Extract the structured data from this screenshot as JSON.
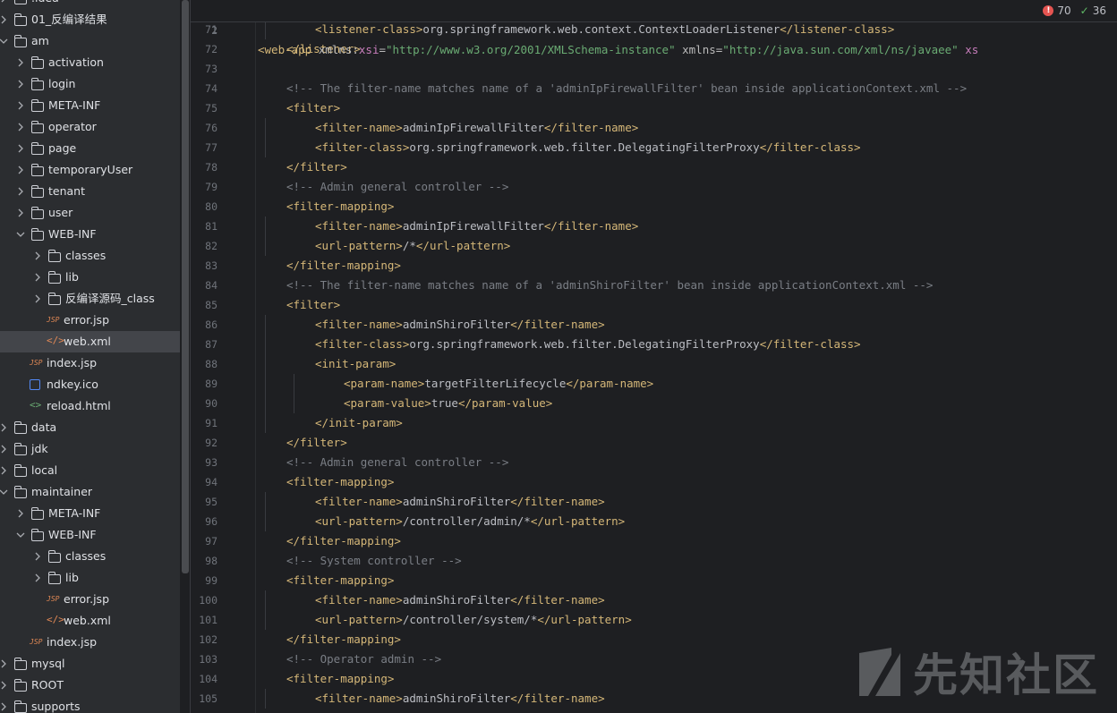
{
  "tree": [
    {
      "label": ".idea",
      "depth": 0,
      "type": "folder",
      "state": "collapsed"
    },
    {
      "label": "01_反编译结果",
      "depth": 0,
      "type": "folder",
      "state": "collapsed"
    },
    {
      "label": "am",
      "depth": 0,
      "type": "folder",
      "state": "expanded"
    },
    {
      "label": "activation",
      "depth": 1,
      "type": "folder",
      "state": "collapsed"
    },
    {
      "label": "login",
      "depth": 1,
      "type": "folder",
      "state": "collapsed"
    },
    {
      "label": "META-INF",
      "depth": 1,
      "type": "folder",
      "state": "collapsed"
    },
    {
      "label": "operator",
      "depth": 1,
      "type": "folder",
      "state": "collapsed"
    },
    {
      "label": "page",
      "depth": 1,
      "type": "folder",
      "state": "collapsed"
    },
    {
      "label": "temporaryUser",
      "depth": 1,
      "type": "folder",
      "state": "collapsed"
    },
    {
      "label": "tenant",
      "depth": 1,
      "type": "folder",
      "state": "collapsed"
    },
    {
      "label": "user",
      "depth": 1,
      "type": "folder",
      "state": "collapsed"
    },
    {
      "label": "WEB-INF",
      "depth": 1,
      "type": "folder",
      "state": "expanded"
    },
    {
      "label": "classes",
      "depth": 2,
      "type": "folder",
      "state": "collapsed"
    },
    {
      "label": "lib",
      "depth": 2,
      "type": "folder",
      "state": "collapsed"
    },
    {
      "label": "反编译源码_class",
      "depth": 2,
      "type": "folder",
      "state": "collapsed"
    },
    {
      "label": "error.jsp",
      "depth": 2,
      "type": "jsp"
    },
    {
      "label": "web.xml",
      "depth": 2,
      "type": "xml",
      "selected": true
    },
    {
      "label": "index.jsp",
      "depth": 1,
      "type": "jsp"
    },
    {
      "label": "ndkey.ico",
      "depth": 1,
      "type": "ico"
    },
    {
      "label": "reload.html",
      "depth": 1,
      "type": "html"
    },
    {
      "label": "data",
      "depth": 0,
      "type": "folder",
      "state": "collapsed"
    },
    {
      "label": "jdk",
      "depth": 0,
      "type": "folder",
      "state": "collapsed"
    },
    {
      "label": "local",
      "depth": 0,
      "type": "folder",
      "state": "collapsed"
    },
    {
      "label": "maintainer",
      "depth": 0,
      "type": "folder",
      "state": "expanded"
    },
    {
      "label": "META-INF",
      "depth": 1,
      "type": "folder",
      "state": "collapsed"
    },
    {
      "label": "WEB-INF",
      "depth": 1,
      "type": "folder",
      "state": "expanded"
    },
    {
      "label": "classes",
      "depth": 2,
      "type": "folder",
      "state": "collapsed"
    },
    {
      "label": "lib",
      "depth": 2,
      "type": "folder",
      "state": "collapsed"
    },
    {
      "label": "error.jsp",
      "depth": 2,
      "type": "jsp"
    },
    {
      "label": "web.xml",
      "depth": 2,
      "type": "xml"
    },
    {
      "label": "index.jsp",
      "depth": 1,
      "type": "jsp"
    },
    {
      "label": "mysql",
      "depth": 0,
      "type": "folder",
      "state": "collapsed"
    },
    {
      "label": "ROOT",
      "depth": 0,
      "type": "folder",
      "state": "collapsed"
    },
    {
      "label": "supports",
      "depth": 0,
      "type": "folder",
      "state": "collapsed"
    }
  ],
  "icons": {
    "jsp": "JSP",
    "xml": "</>",
    "html": "<>"
  },
  "sticky_line": {
    "number": "2",
    "tokens": [
      [
        "t",
        "<web-app "
      ],
      [
        "a",
        "xmlns:"
      ],
      [
        "ns",
        "xsi"
      ],
      [
        "a",
        "="
      ],
      [
        "s",
        "\"http://www.w3.org/2001/XMLSchema-instance\""
      ],
      [
        "a",
        " xmlns="
      ],
      [
        "s",
        "\"http://java.sun.com/xml/ns/javaee\""
      ],
      [
        "a",
        " "
      ],
      [
        "ns",
        "xs"
      ]
    ]
  },
  "inspections": {
    "errors": "70",
    "ok": "36"
  },
  "code_lines": [
    {
      "n": "71",
      "indent": 2,
      "tokens": [
        [
          "t",
          "<listener-class>"
        ],
        [
          "p",
          "org.springframework.web.context.ContextLoaderListener"
        ],
        [
          "t",
          "</listener-class>"
        ]
      ]
    },
    {
      "n": "72",
      "indent": 1,
      "tokens": [
        [
          "t",
          "</listener>"
        ]
      ]
    },
    {
      "n": "73",
      "indent": 0,
      "tokens": []
    },
    {
      "n": "74",
      "indent": 1,
      "tokens": [
        [
          "c",
          "<!-- The filter-name matches name of a 'adminIpFirewallFilter' bean inside applicationContext.xml -->"
        ]
      ]
    },
    {
      "n": "75",
      "indent": 1,
      "tokens": [
        [
          "t",
          "<filter>"
        ]
      ]
    },
    {
      "n": "76",
      "indent": 2,
      "tokens": [
        [
          "t",
          "<filter-name>"
        ],
        [
          "p",
          "adminIpFirewallFilter"
        ],
        [
          "t",
          "</filter-name>"
        ]
      ]
    },
    {
      "n": "77",
      "indent": 2,
      "tokens": [
        [
          "t",
          "<filter-class>"
        ],
        [
          "p",
          "org.springframework.web.filter.DelegatingFilterProxy"
        ],
        [
          "t",
          "</filter-class>"
        ]
      ]
    },
    {
      "n": "78",
      "indent": 1,
      "tokens": [
        [
          "t",
          "</filter>"
        ]
      ]
    },
    {
      "n": "79",
      "indent": 1,
      "tokens": [
        [
          "c",
          "<!-- Admin general controller -->"
        ]
      ]
    },
    {
      "n": "80",
      "indent": 1,
      "tokens": [
        [
          "t",
          "<filter-mapping>"
        ]
      ]
    },
    {
      "n": "81",
      "indent": 2,
      "tokens": [
        [
          "t",
          "<filter-name>"
        ],
        [
          "p",
          "adminIpFirewallFilter"
        ],
        [
          "t",
          "</filter-name>"
        ]
      ]
    },
    {
      "n": "82",
      "indent": 2,
      "tokens": [
        [
          "t",
          "<url-pattern>"
        ],
        [
          "p",
          "/*"
        ],
        [
          "t",
          "</url-pattern>"
        ]
      ]
    },
    {
      "n": "83",
      "indent": 1,
      "tokens": [
        [
          "t",
          "</filter-mapping>"
        ]
      ]
    },
    {
      "n": "84",
      "indent": 1,
      "tokens": [
        [
          "c",
          "<!-- The filter-name matches name of a 'adminShiroFilter' bean inside applicationContext.xml -->"
        ]
      ]
    },
    {
      "n": "85",
      "indent": 1,
      "tokens": [
        [
          "t",
          "<filter>"
        ]
      ]
    },
    {
      "n": "86",
      "indent": 2,
      "tokens": [
        [
          "t",
          "<filter-name>"
        ],
        [
          "p",
          "adminShiroFilter"
        ],
        [
          "t",
          "</filter-name>"
        ]
      ]
    },
    {
      "n": "87",
      "indent": 2,
      "tokens": [
        [
          "t",
          "<filter-class>"
        ],
        [
          "p",
          "org.springframework.web.filter.DelegatingFilterProxy"
        ],
        [
          "t",
          "</filter-class>"
        ]
      ]
    },
    {
      "n": "88",
      "indent": 2,
      "tokens": [
        [
          "t",
          "<init-param>"
        ]
      ]
    },
    {
      "n": "89",
      "indent": 3,
      "tokens": [
        [
          "t",
          "<param-name>"
        ],
        [
          "p",
          "targetFilterLifecycle"
        ],
        [
          "t",
          "</param-name>"
        ]
      ]
    },
    {
      "n": "90",
      "indent": 3,
      "tokens": [
        [
          "t",
          "<param-value>"
        ],
        [
          "p",
          "true"
        ],
        [
          "t",
          "</param-value>"
        ]
      ]
    },
    {
      "n": "91",
      "indent": 2,
      "tokens": [
        [
          "t",
          "</init-param>"
        ]
      ]
    },
    {
      "n": "92",
      "indent": 1,
      "tokens": [
        [
          "t",
          "</filter>"
        ]
      ]
    },
    {
      "n": "93",
      "indent": 1,
      "tokens": [
        [
          "c",
          "<!-- Admin general controller -->"
        ]
      ]
    },
    {
      "n": "94",
      "indent": 1,
      "tokens": [
        [
          "t",
          "<filter-mapping>"
        ]
      ]
    },
    {
      "n": "95",
      "indent": 2,
      "tokens": [
        [
          "t",
          "<filter-name>"
        ],
        [
          "p",
          "adminShiroFilter"
        ],
        [
          "t",
          "</filter-name>"
        ]
      ]
    },
    {
      "n": "96",
      "indent": 2,
      "tokens": [
        [
          "t",
          "<url-pattern>"
        ],
        [
          "p",
          "/controller/admin/*"
        ],
        [
          "t",
          "</url-pattern>"
        ]
      ]
    },
    {
      "n": "97",
      "indent": 1,
      "tokens": [
        [
          "t",
          "</filter-mapping>"
        ]
      ]
    },
    {
      "n": "98",
      "indent": 1,
      "tokens": [
        [
          "c",
          "<!-- System controller -->"
        ]
      ]
    },
    {
      "n": "99",
      "indent": 1,
      "tokens": [
        [
          "t",
          "<filter-mapping>"
        ]
      ]
    },
    {
      "n": "100",
      "indent": 2,
      "tokens": [
        [
          "t",
          "<filter-name>"
        ],
        [
          "p",
          "adminShiroFilter"
        ],
        [
          "t",
          "</filter-name>"
        ]
      ]
    },
    {
      "n": "101",
      "indent": 2,
      "tokens": [
        [
          "t",
          "<url-pattern>"
        ],
        [
          "p",
          "/controller/system/*"
        ],
        [
          "t",
          "</url-pattern>"
        ]
      ]
    },
    {
      "n": "102",
      "indent": 1,
      "tokens": [
        [
          "t",
          "</filter-mapping>"
        ]
      ]
    },
    {
      "n": "103",
      "indent": 1,
      "tokens": [
        [
          "c",
          "<!-- Operator admin -->"
        ]
      ]
    },
    {
      "n": "104",
      "indent": 1,
      "tokens": [
        [
          "t",
          "<filter-mapping>"
        ]
      ]
    },
    {
      "n": "105",
      "indent": 2,
      "tokens": [
        [
          "t",
          "<filter-name>"
        ],
        [
          "p",
          "adminShiroFilter"
        ],
        [
          "t",
          "</filter-name>"
        ]
      ]
    }
  ],
  "watermark": {
    "text": "先知社区"
  }
}
